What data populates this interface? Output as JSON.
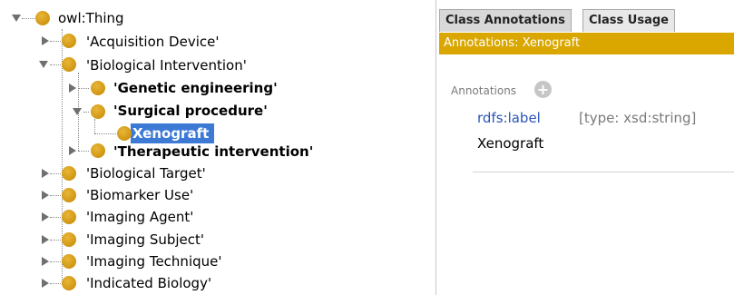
{
  "tree": {
    "root": "owl:Thing",
    "items": {
      "acquisition_device": "'Acquisition Device'",
      "biological_intervention": "'Biological Intervention'",
      "genetic_engineering": "'Genetic engineering'",
      "surgical_procedure": "'Surgical procedure'",
      "xenograft": "Xenograft",
      "therapeutic_intervention": "'Therapeutic intervention'",
      "biological_target": "'Biological Target'",
      "biomarker_use": "'Biomarker Use'",
      "imaging_agent": "'Imaging Agent'",
      "imaging_subject": "'Imaging Subject'",
      "imaging_technique": "'Imaging Technique'",
      "indicated_biology": "'Indicated Biology'"
    },
    "node_icon": "class-circle-icon",
    "node_color": "#d4a017",
    "selected_color": "#3d7ad6"
  },
  "tabs": {
    "class_annotations": "Class Annotations",
    "class_usage": "Class Usage"
  },
  "annotations": {
    "header": "Annotations: Xenograft",
    "section_label": "Annotations",
    "add_icon": "plus-icon",
    "property": "rdfs:label",
    "type": "[type: xsd:string]",
    "value": "Xenograft",
    "header_color": "#d9a700"
  }
}
